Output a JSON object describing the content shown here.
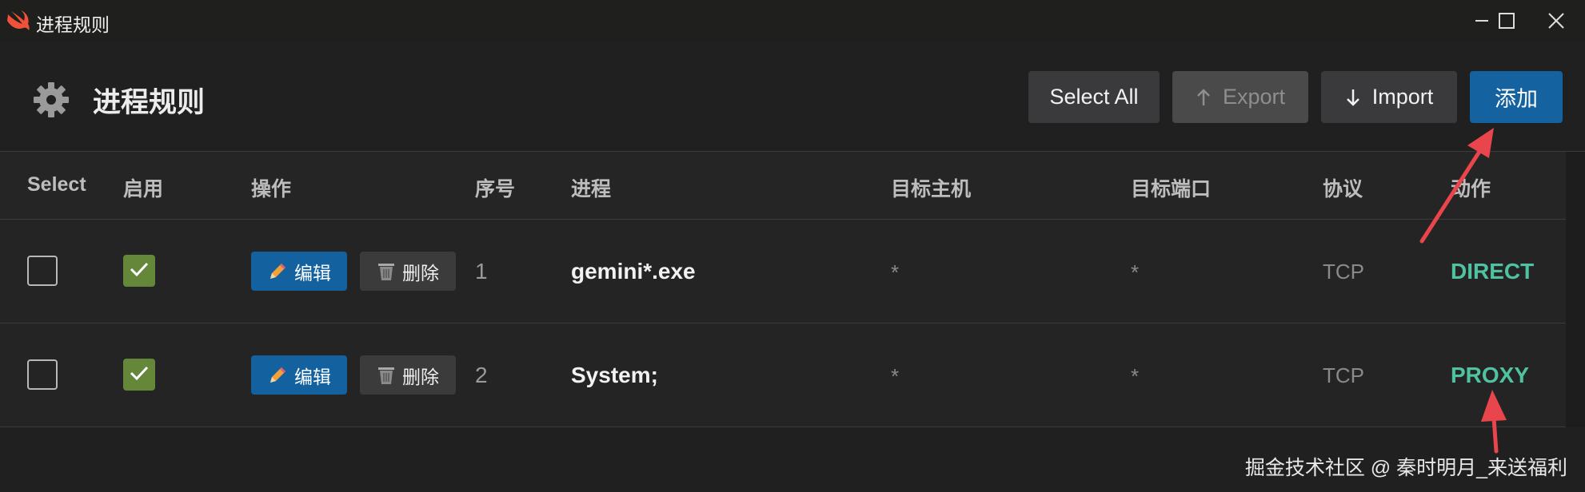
{
  "window": {
    "title": "进程规则",
    "controls": {
      "minimize": "minimize",
      "maximize": "maximize",
      "close": "close"
    }
  },
  "header": {
    "title": "进程规则",
    "buttons": {
      "select_all": "Select All",
      "export": "Export",
      "import": "Import",
      "add": "添加"
    }
  },
  "table": {
    "columns": [
      "Select",
      "启用",
      "操作",
      "序号",
      "进程",
      "目标主机",
      "目标端口",
      "协议",
      "动作"
    ],
    "rows": [
      {
        "selected": false,
        "enabled": true,
        "edit_label": "编辑",
        "delete_label": "删除",
        "index": "1",
        "process": "gemini*.exe",
        "target_host": "*",
        "target_port": "*",
        "protocol": "TCP",
        "action": "DIRECT"
      },
      {
        "selected": false,
        "enabled": true,
        "edit_label": "编辑",
        "delete_label": "删除",
        "index": "2",
        "process": "System;",
        "target_host": "*",
        "target_port": "*",
        "protocol": "TCP",
        "action": "PROXY"
      }
    ]
  },
  "watermark": "掘金技术社区 @ 秦时明月_来送福利",
  "colors": {
    "accent_blue": "#1462a0",
    "action_green": "#4fc3a1",
    "checkbox_green": "#64873a",
    "annotation_red": "#e8454c"
  }
}
